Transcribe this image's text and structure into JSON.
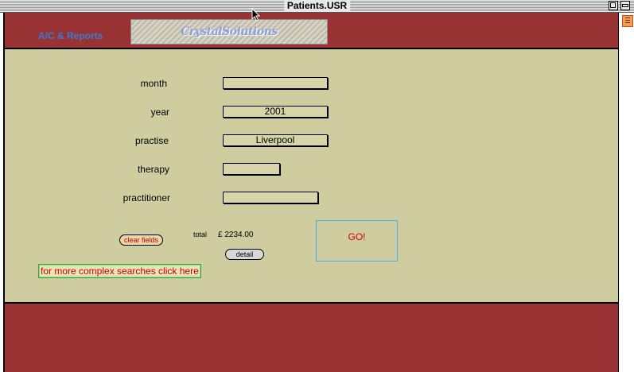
{
  "window": {
    "title": "Patients.USR"
  },
  "header": {
    "nav_link": "A/C & Reports",
    "logo_text": "CrystalSolutions"
  },
  "form": {
    "fields": [
      {
        "label": "month",
        "value": ""
      },
      {
        "label": "year",
        "value": "2001"
      },
      {
        "label": "practise",
        "value": "Liverpool"
      },
      {
        "label": "therapy",
        "value": ""
      },
      {
        "label": "practitioner",
        "value": ""
      }
    ],
    "clear_label": "clear fields",
    "total_label": "total",
    "total_value": "£ 2234.00",
    "detail_label": "detail",
    "go_label": "GO!",
    "complex_search_label": "for more complex searches click here",
    "side_marks": [
      "²",
      "¹"
    ]
  },
  "colors": {
    "frame": "#993333",
    "panel": "#cfcd9f",
    "link_blue": "#3a7bd5",
    "alert_red": "#cc0000"
  }
}
